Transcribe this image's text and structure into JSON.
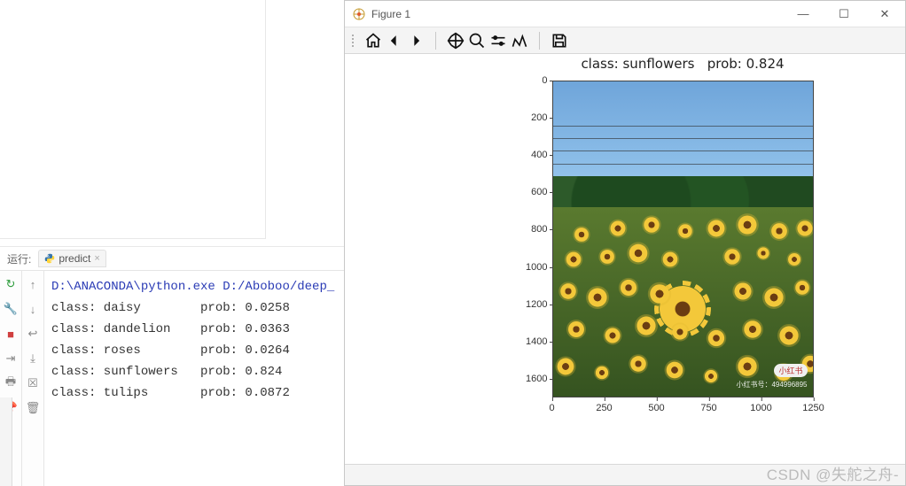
{
  "ide": {
    "run_label": "运行:",
    "tab_name": "predict",
    "cmd_line": "D:\\ANACONDA\\python.exe D:/Aboboo/deep_",
    "results": [
      {
        "cls": "daisy",
        "prob": "0.0258"
      },
      {
        "cls": "dandelion",
        "prob": "0.0363"
      },
      {
        "cls": "roses",
        "prob": "0.0264"
      },
      {
        "cls": "sunflowers",
        "prob": "0.824"
      },
      {
        "cls": "tulips",
        "prob": "0.0872"
      }
    ]
  },
  "figure": {
    "window_title": "Figure 1",
    "plot_title": "class: sunflowers   prob: 0.824",
    "image_badge": "小红书",
    "image_wm": "小红书号：494996895"
  },
  "chart_data": {
    "type": "image",
    "title": "class: sunflowers   prob: 0.824",
    "xlabel": "",
    "ylabel": "",
    "xlim": [
      0,
      1250
    ],
    "ylim": [
      1700,
      0
    ],
    "y_ticks": [
      0,
      200,
      400,
      600,
      800,
      1000,
      1200,
      1400,
      1600
    ],
    "x_ticks": [
      0,
      250,
      500,
      750,
      1000,
      1250
    ],
    "content": "photograph of a sunflower field under blue sky with power lines and trees; one large sunflower in center"
  },
  "watermark": "CSDN @失舵之舟-"
}
